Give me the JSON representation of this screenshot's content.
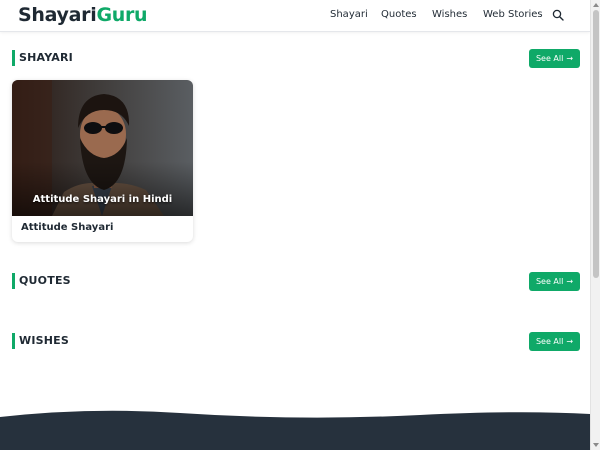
{
  "brand": {
    "part1": "Shayari",
    "part2": "Guru",
    "accent": "#0fa968"
  },
  "nav": {
    "items": [
      {
        "label": "Shayari"
      },
      {
        "label": "Quotes"
      },
      {
        "label": "Wishes"
      },
      {
        "label": "Web Stories"
      }
    ],
    "search_icon": "search-icon"
  },
  "sections": {
    "shayari": {
      "title": "SHAYARI",
      "see_all": "See All",
      "arrow": "→"
    },
    "quotes": {
      "title": "QUOTES",
      "see_all": "See All",
      "arrow": "→"
    },
    "wishes": {
      "title": "WISHES",
      "see_all": "See All",
      "arrow": "→"
    }
  },
  "cards": [
    {
      "overlay": "Attitude Shayari in Hindi",
      "title": "Attitude Shayari"
    }
  ],
  "colors": {
    "footer": "#26313d",
    "text": "#1f2933"
  }
}
